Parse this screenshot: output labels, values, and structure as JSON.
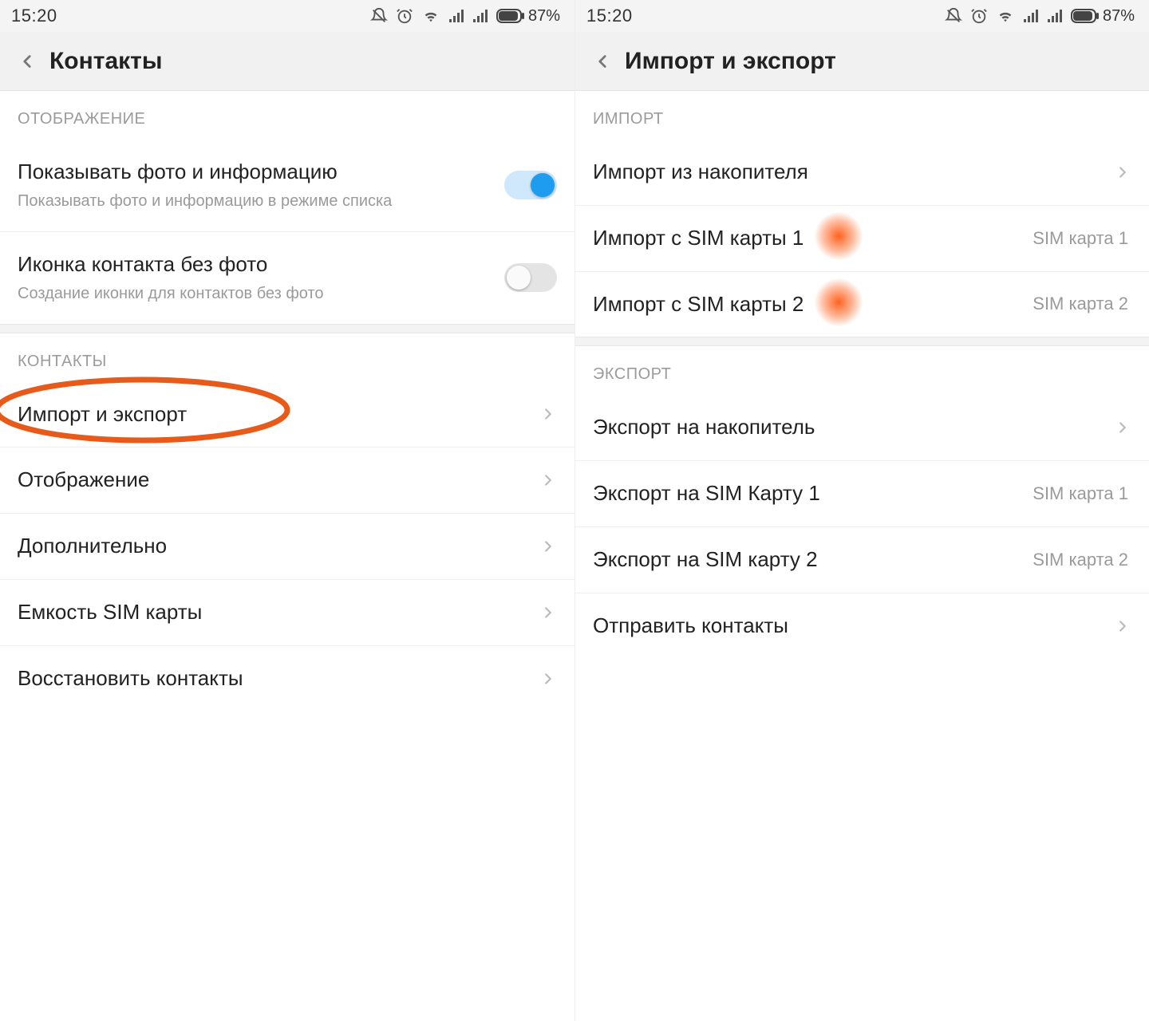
{
  "status": {
    "time": "15:20",
    "battery_pct": "87%"
  },
  "left": {
    "header_title": "Контакты",
    "section_display": "ОТОБРАЖЕНИЕ",
    "row_photo_title": "Показывать фото и информацию",
    "row_photo_sub": "Показывать фото и информацию в режиме списка",
    "row_icon_title": "Иконка контакта без фото",
    "row_icon_sub": "Создание иконки для контактов без фото",
    "section_contacts": "КОНТАКТЫ",
    "row_import_export": "Импорт и экспорт",
    "row_display": "Отображение",
    "row_more": "Дополнительно",
    "row_sim_capacity": "Емкость SIM карты",
    "row_restore": "Восстановить контакты"
  },
  "right": {
    "header_title": "Импорт и экспорт",
    "section_import": "ИМПОРТ",
    "row_import_storage": "Импорт из накопителя",
    "row_import_sim1": "Импорт с SIM карты 1",
    "row_import_sim1_val": "SIM карта 1",
    "row_import_sim2": "Импорт с SIM карты 2",
    "row_import_sim2_val": "SIM карта 2",
    "section_export": "ЭКСПОРТ",
    "row_export_storage": "Экспорт на накопитель",
    "row_export_sim1": "Экспорт на SIM Карту 1",
    "row_export_sim1_val": "SIM карта 1",
    "row_export_sim2": "Экспорт на SIM карту 2",
    "row_export_sim2_val": "SIM карта 2",
    "row_send": "Отправить контакты"
  }
}
